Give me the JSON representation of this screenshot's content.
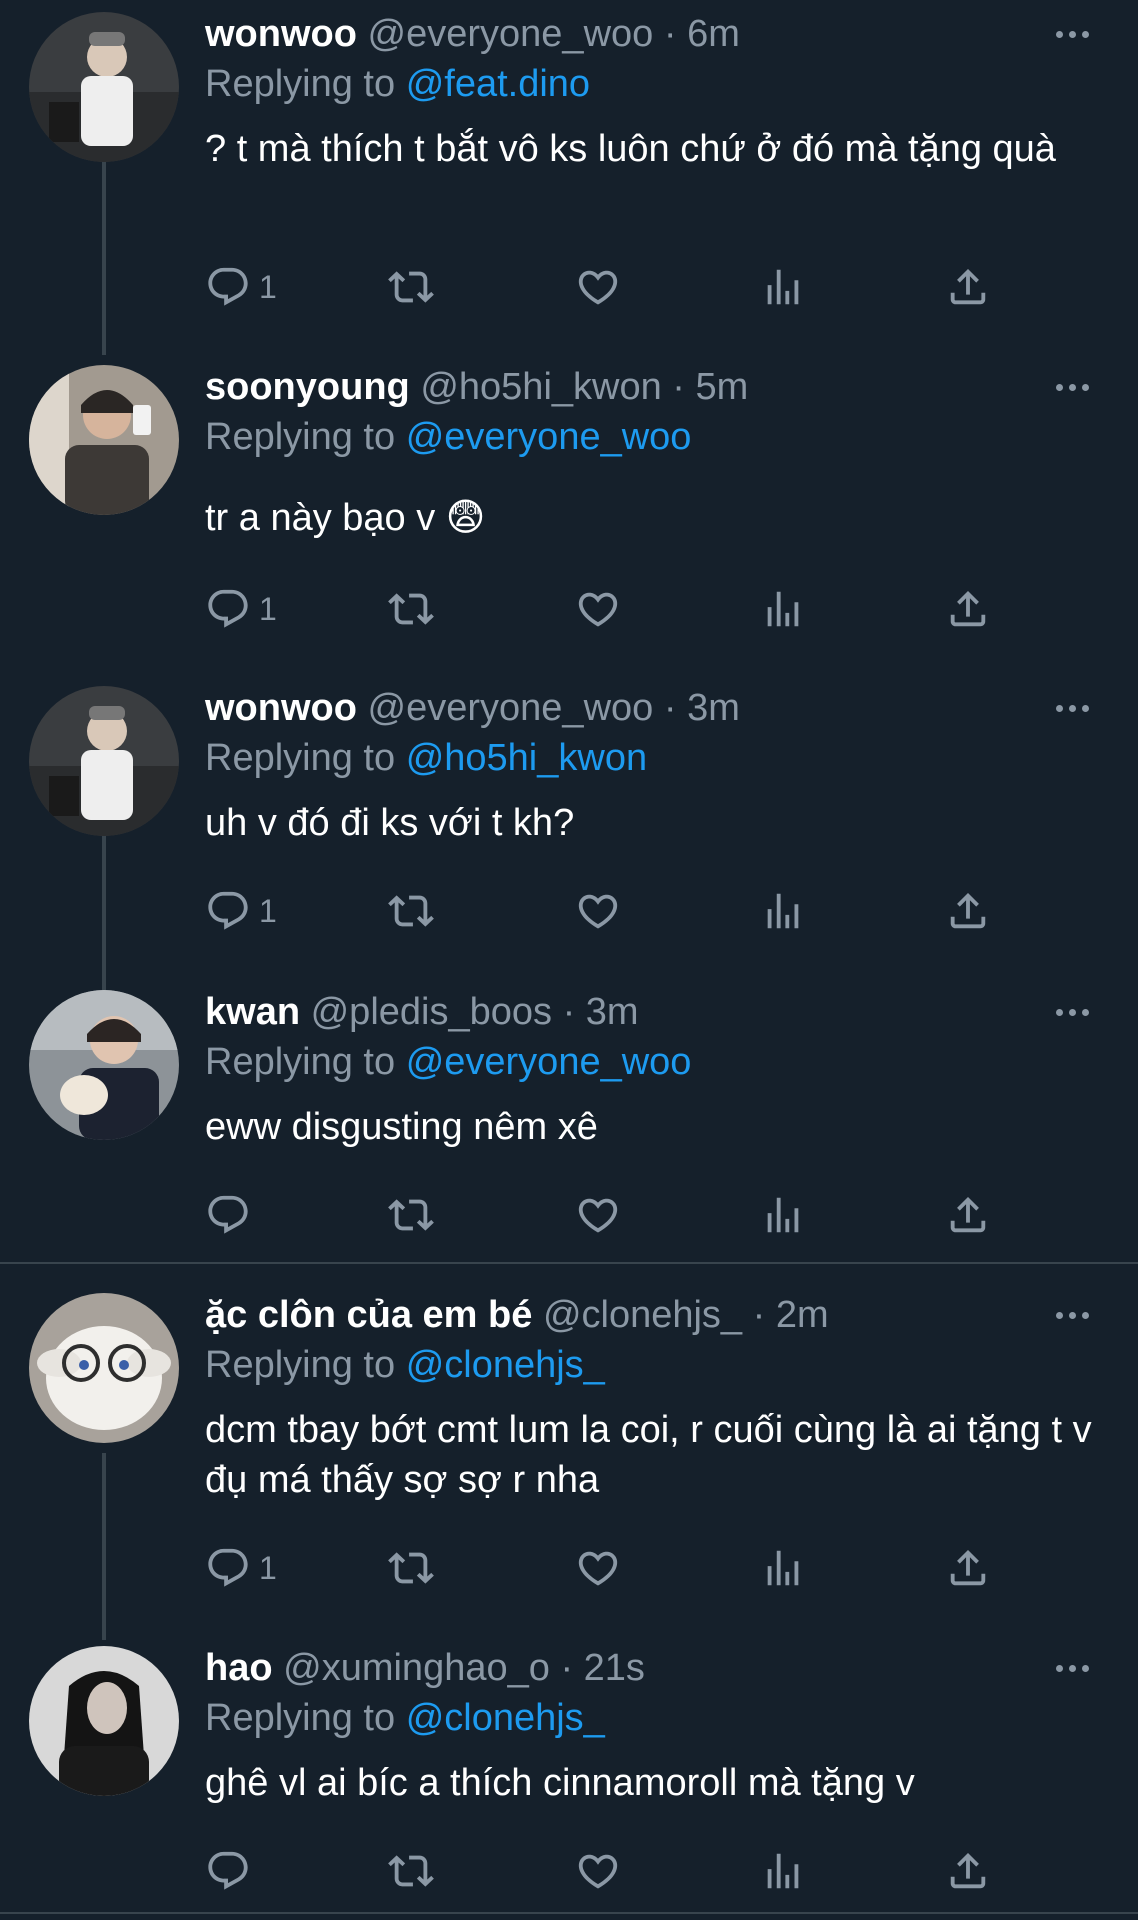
{
  "colors": {
    "background": "#15202b",
    "text": "#ffffff",
    "muted": "#8b98a5",
    "accent": "#1d9bf0",
    "line": "#38444d"
  },
  "icons": {
    "reply": "reply-icon",
    "retweet": "retweet-icon",
    "like": "heart-icon",
    "views": "views-icon",
    "share": "share-icon",
    "more": "more-icon"
  },
  "replying_prefix": "Replying to",
  "tweets": [
    {
      "name": "wonwoo",
      "handle": "@everyone_woo",
      "dot": "·",
      "time": "6m",
      "reply_to": "@feat.dino",
      "text": "? t mà thích t bắt vô ks luôn chứ ở đó mà tặng quà",
      "replies": "1"
    },
    {
      "name": "soonyoung",
      "handle": "@ho5hi_kwon",
      "dot": "·",
      "time": "5m",
      "reply_to": "@everyone_woo",
      "text": "tr a này bạo v 😨",
      "replies": "1"
    },
    {
      "name": "wonwoo",
      "handle": "@everyone_woo",
      "dot": "·",
      "time": "3m",
      "reply_to": "@ho5hi_kwon",
      "text": "uh v đó đi ks với t kh?",
      "replies": "1"
    },
    {
      "name": "kwan",
      "handle": "@pledis_boos",
      "dot": "·",
      "time": "3m",
      "reply_to": "@everyone_woo",
      "text": "eww disgusting nêm xê",
      "replies": ""
    },
    {
      "name": "ặc clôn của em bé",
      "handle": "@clonehjs_",
      "dot": "·",
      "time": "2m",
      "reply_to": "@clonehjs_",
      "text": "dcm tbay bớt cmt lum la coi, r cuối cùng là ai tặng t v đụ má thấy sợ sợ r nha",
      "replies": "1"
    },
    {
      "name": "hao",
      "handle": "@xuminghao_o",
      "dot": "·",
      "time": "21s",
      "reply_to": "@clonehjs_",
      "text": "ghê vl ai bíc a thích cinnamoroll mà tặng v",
      "replies": ""
    }
  ]
}
